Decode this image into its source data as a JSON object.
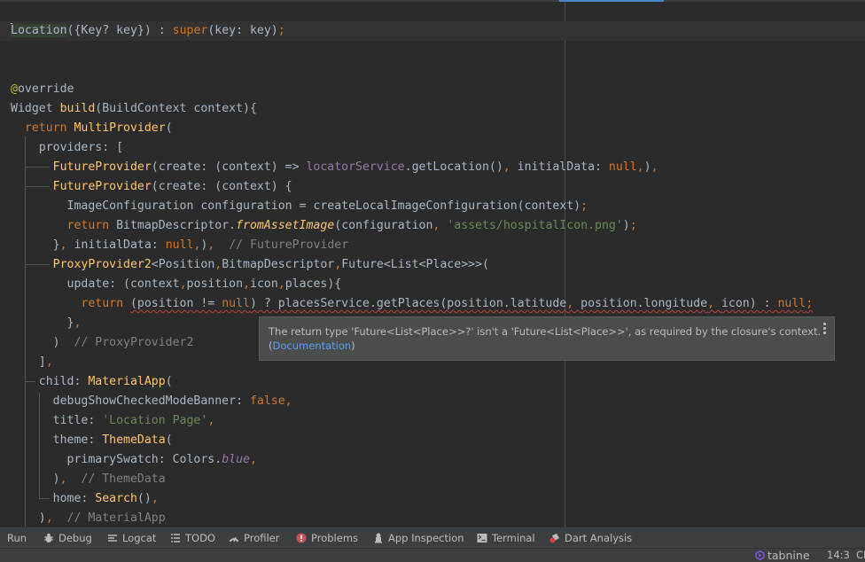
{
  "editor": {
    "lines": [
      {
        "id": "l1",
        "tokens": [
          [
            "Location",
            "plain hl"
          ],
          [
            "({Key? key}) : ",
            "plain"
          ],
          [
            "super",
            "kw"
          ],
          [
            "(key: key)",
            "plain"
          ],
          [
            ";",
            "kw"
          ]
        ]
      },
      {
        "id": "l2",
        "tokens": []
      },
      {
        "id": "l3",
        "tokens": []
      },
      {
        "id": "l4",
        "tokens": [
          [
            "@",
            "ann"
          ],
          [
            "override",
            "plain"
          ]
        ]
      },
      {
        "id": "l5",
        "tokens": [
          [
            "Widget ",
            "plain"
          ],
          [
            "build",
            "fn"
          ],
          [
            "(BuildContext context){",
            "plain"
          ]
        ]
      },
      {
        "id": "l6",
        "tokens": [
          [
            "  ",
            "plain"
          ],
          [
            "return ",
            "kw"
          ],
          [
            "MultiProvider",
            "fn"
          ],
          [
            "(",
            "plain"
          ]
        ]
      },
      {
        "id": "l7",
        "tokens": [
          [
            "    providers: [",
            "plain"
          ]
        ]
      },
      {
        "id": "l8",
        "tokens": [
          [
            "      ",
            "plain"
          ],
          [
            "FutureProvider",
            "fn"
          ],
          [
            "(create: (context) => ",
            "plain"
          ],
          [
            "locatorService",
            "field"
          ],
          [
            ".getLocation()",
            "plain"
          ],
          [
            ", ",
            "kw"
          ],
          [
            "initialData: ",
            "plain"
          ],
          [
            "null",
            "kw"
          ],
          [
            ",",
            "kw"
          ],
          [
            ")",
            "plain"
          ],
          [
            ",",
            "kw"
          ]
        ]
      },
      {
        "id": "l9",
        "tokens": [
          [
            "      ",
            "plain"
          ],
          [
            "FutureProvider",
            "fn"
          ],
          [
            "(create: (context) {",
            "plain"
          ]
        ]
      },
      {
        "id": "l10",
        "tokens": [
          [
            "        ImageConfiguration configuration = createLocalImageConfiguration(context)",
            "plain"
          ],
          [
            ";",
            "kw"
          ]
        ]
      },
      {
        "id": "l11",
        "tokens": [
          [
            "        ",
            "plain"
          ],
          [
            "return ",
            "kw"
          ],
          [
            "BitmapDescriptor.",
            "plain"
          ],
          [
            "fromAssetImage",
            "fn ital"
          ],
          [
            "(configuration",
            "plain"
          ],
          [
            ", ",
            "kw"
          ],
          [
            "'assets/hospitalIcon.png'",
            "str"
          ],
          [
            ")",
            "plain"
          ],
          [
            ";",
            "kw"
          ]
        ]
      },
      {
        "id": "l12",
        "tokens": [
          [
            "      }",
            "plain"
          ],
          [
            ", ",
            "kw"
          ],
          [
            "initialData: ",
            "plain"
          ],
          [
            "null",
            "kw"
          ],
          [
            ",",
            "kw"
          ],
          [
            ")",
            "plain"
          ],
          [
            ",",
            "kw"
          ],
          [
            "  // FutureProvider",
            "cmt"
          ]
        ]
      },
      {
        "id": "l13",
        "tokens": [
          [
            "      ",
            "plain"
          ],
          [
            "ProxyProvider2",
            "fn"
          ],
          [
            "<Position",
            "plain"
          ],
          [
            ",",
            "kw"
          ],
          [
            "BitmapDescriptor",
            "plain"
          ],
          [
            ",",
            "kw"
          ],
          [
            "Future<List<Place>>>(",
            "plain"
          ]
        ]
      },
      {
        "id": "l14",
        "tokens": [
          [
            "        update: (context",
            "plain"
          ],
          [
            ",",
            "kw"
          ],
          [
            "position",
            "plain"
          ],
          [
            ",",
            "kw"
          ],
          [
            "icon",
            "plain"
          ],
          [
            ",",
            "kw"
          ],
          [
            "places){",
            "plain"
          ]
        ]
      },
      {
        "id": "l15",
        "tokens": [
          [
            "          ",
            "plain"
          ],
          [
            "return ",
            "kw"
          ],
          [
            "(position != ",
            "plain err"
          ],
          [
            "null",
            "kw err"
          ],
          [
            ") ? placesService.getPlaces(position.latitude",
            "plain err"
          ],
          [
            ", ",
            "kw err"
          ],
          [
            "position.longitude",
            "plain err"
          ],
          [
            ", ",
            "kw err"
          ],
          [
            "icon) : ",
            "plain err"
          ],
          [
            "null",
            "kw err"
          ],
          [
            ";",
            "kw err"
          ]
        ]
      },
      {
        "id": "l16",
        "tokens": [
          [
            "        }",
            "plain"
          ],
          [
            ",",
            "kw"
          ]
        ]
      },
      {
        "id": "l17",
        "tokens": [
          [
            "      )",
            "plain"
          ],
          [
            "  // ProxyProvider2",
            "cmt"
          ]
        ]
      },
      {
        "id": "l18",
        "tokens": [
          [
            "    ]",
            "plain"
          ],
          [
            ",",
            "kw"
          ]
        ]
      },
      {
        "id": "l19",
        "tokens": [
          [
            "    child: ",
            "plain"
          ],
          [
            "MaterialApp",
            "fn"
          ],
          [
            "(",
            "plain"
          ]
        ]
      },
      {
        "id": "l20",
        "tokens": [
          [
            "      debugShowCheckedModeBanner: ",
            "plain"
          ],
          [
            "false",
            "kw"
          ],
          [
            ",",
            "kw"
          ]
        ]
      },
      {
        "id": "l21",
        "tokens": [
          [
            "      title: ",
            "plain"
          ],
          [
            "'Location Page'",
            "str"
          ],
          [
            ",",
            "kw"
          ]
        ]
      },
      {
        "id": "l22",
        "tokens": [
          [
            "      theme: ",
            "plain"
          ],
          [
            "ThemeData",
            "fn"
          ],
          [
            "(",
            "plain"
          ]
        ]
      },
      {
        "id": "l23",
        "tokens": [
          [
            "        primarySwatch: Colors.",
            "plain"
          ],
          [
            "blue",
            "italfield"
          ],
          [
            ",",
            "kw"
          ]
        ]
      },
      {
        "id": "l24",
        "tokens": [
          [
            "      )",
            "plain"
          ],
          [
            ",",
            "kw"
          ],
          [
            "  // ThemeData",
            "cmt"
          ]
        ]
      },
      {
        "id": "l25",
        "tokens": [
          [
            "      home: ",
            "plain"
          ],
          [
            "Search",
            "fn"
          ],
          [
            "()",
            "plain"
          ],
          [
            ",",
            "kw"
          ]
        ]
      },
      {
        "id": "l26",
        "tokens": [
          [
            "    )",
            "plain"
          ],
          [
            ",",
            "kw"
          ],
          [
            "  // MaterialApp",
            "cmt"
          ]
        ]
      }
    ]
  },
  "tooltip": {
    "message": "The return type 'Future<List<Place>>?' isn't a 'Future<List<Place>>', as required by the closure's context.",
    "open_paren": "(",
    "link_label": "Documentation",
    "close_paren": ")"
  },
  "tool_windows": [
    {
      "label": "Run",
      "icon": "run-icon"
    },
    {
      "label": "Debug",
      "icon": "bug-icon"
    },
    {
      "label": "Logcat",
      "icon": "logcat-icon"
    },
    {
      "label": "TODO",
      "icon": "list-icon"
    },
    {
      "label": "Profiler",
      "icon": "gauge-icon"
    },
    {
      "label": "Problems",
      "icon": "error-icon"
    },
    {
      "label": "App Inspection",
      "icon": "inspection-icon"
    },
    {
      "label": "Terminal",
      "icon": "terminal-icon"
    },
    {
      "label": "Dart Analysis",
      "icon": "dart-analysis-icon"
    }
  ],
  "status": {
    "plugin": "tabnine",
    "cursor_position": "14:3",
    "line_separator": "CR"
  },
  "colors": {
    "accent": "#4a88c7",
    "error": "#bc3f3c",
    "tabnine": "#8a5cf5"
  }
}
